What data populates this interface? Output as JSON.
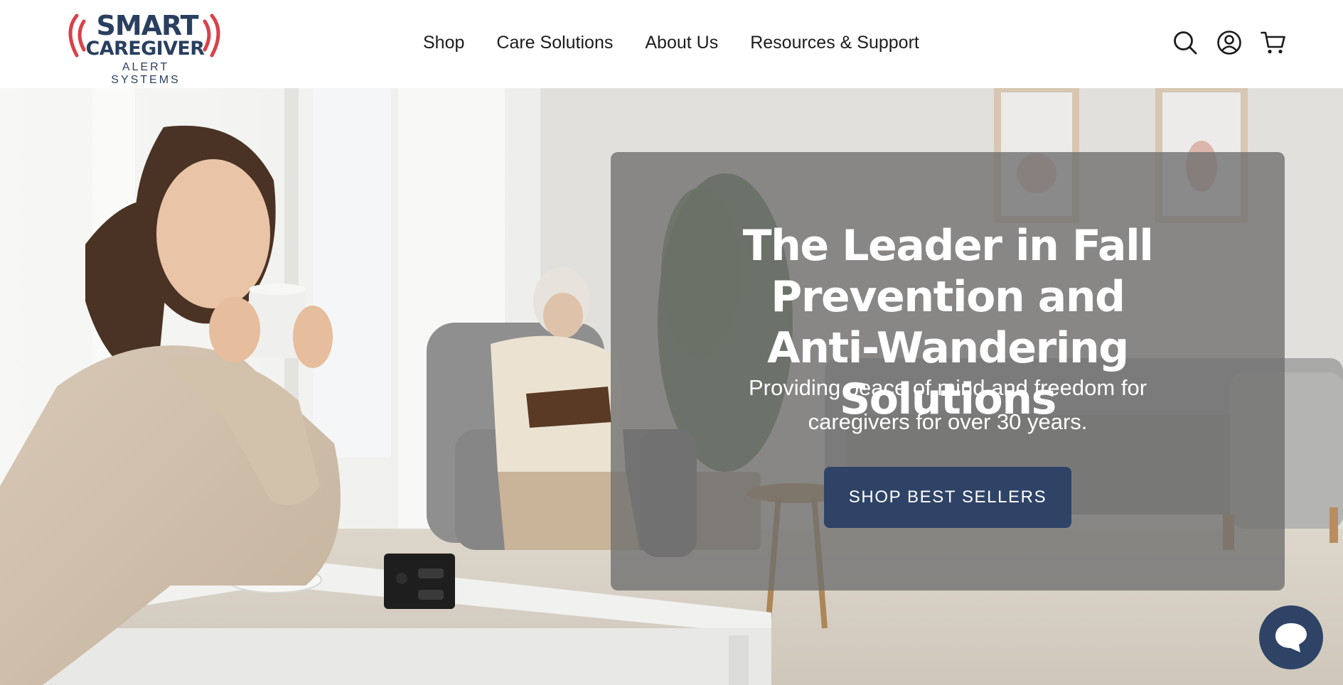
{
  "brand": {
    "line1": "SMART",
    "line2": "CAREGIVER",
    "line3": "ALERT SYSTEMS",
    "logo_icon": "signal-waves-icon",
    "colors": {
      "navy": "#2a3f5f",
      "red": "#d9414a"
    }
  },
  "nav": {
    "items": [
      {
        "label": "Shop"
      },
      {
        "label": "Care Solutions"
      },
      {
        "label": "About Us"
      },
      {
        "label": "Resources & Support"
      }
    ]
  },
  "header_icons": [
    "search-icon",
    "account-icon",
    "cart-icon"
  ],
  "hero": {
    "title": "The Leader in Fall Prevention and Anti-Wandering Solutions",
    "subtitle": "Providing peace of mind and freedom for caregivers for over 30 years.",
    "cta_label": "SHOP BEST SELLERS",
    "cta_color": "#2e4366"
  },
  "chat": {
    "icon": "chat-bubble-icon",
    "color": "#2e4366"
  }
}
